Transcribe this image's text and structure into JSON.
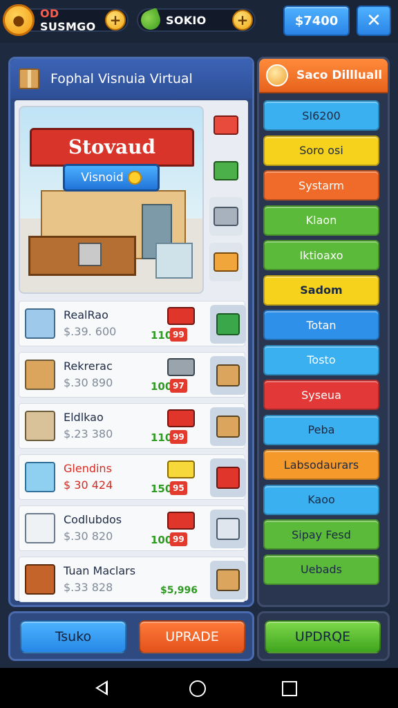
{
  "hud": {
    "res1_prefix": "OD",
    "res1_value": "SUSMGO",
    "res2_value": "SOKIO",
    "money": "$7400"
  },
  "left_panel": {
    "title": "Fophal Visnuia Virtual",
    "shop": {
      "awning_text": "Stovaud",
      "sign_text": "Visnoid"
    },
    "items": [
      {
        "name": "RealRao",
        "price": "$.39. 600",
        "qty": "110",
        "cost": "99",
        "name_red": false
      },
      {
        "name": "Rekrerac",
        "price": "$.30 890",
        "qty": "100",
        "cost": "97",
        "name_red": false
      },
      {
        "name": "Eldlkao",
        "price": "$.23 380",
        "qty": "110",
        "cost": "99",
        "name_red": false
      },
      {
        "name": "Glendins",
        "price": "$ 30 424",
        "qty": "150",
        "cost": "95",
        "name_red": true
      },
      {
        "name": "Codlubdos",
        "price": "$.30 820",
        "qty": "100",
        "cost": "99",
        "name_red": false
      },
      {
        "name": "Tuan Maclars",
        "price": "$.33 828",
        "qty": "",
        "cost": "$5,996",
        "name_red": false
      }
    ]
  },
  "right_panel": {
    "title": "Saco Dillluall",
    "categories": [
      {
        "label": "SI6200",
        "color": "#3ab0f0",
        "style": "dark"
      },
      {
        "label": "Soro osi",
        "color": "#f7d21c",
        "style": "dark"
      },
      {
        "label": "Systarm",
        "color": "#f06b2a",
        "style": "light"
      },
      {
        "label": "Klaon",
        "color": "#5cba3a",
        "style": "light"
      },
      {
        "label": "Iktioaxo",
        "color": "#5cba3a",
        "style": "light"
      },
      {
        "label": "Sadom",
        "color": "#f7d21c",
        "style": "dark-bold"
      },
      {
        "label": "Totan",
        "color": "#2f90ea",
        "style": "light"
      },
      {
        "label": "Tosto",
        "color": "#3ab0f0",
        "style": "light"
      },
      {
        "label": "Syseua",
        "color": "#e23838",
        "style": "light"
      },
      {
        "label": "Peba",
        "color": "#3ab0f0",
        "style": "dark"
      },
      {
        "label": "Labsodaurars",
        "color": "#f59a2a",
        "style": "dark"
      },
      {
        "label": "Kaoo",
        "color": "#3ab0f0",
        "style": "dark"
      },
      {
        "label": "Sipay Fesd",
        "color": "#5cba3a",
        "style": "dark"
      },
      {
        "label": "Uebads",
        "color": "#5cba3a",
        "style": "dark"
      }
    ]
  },
  "actions": {
    "trade_label": "Tsuko",
    "upgrade_label": "UPRADE",
    "upgrade2_label": "UPDRQE"
  }
}
